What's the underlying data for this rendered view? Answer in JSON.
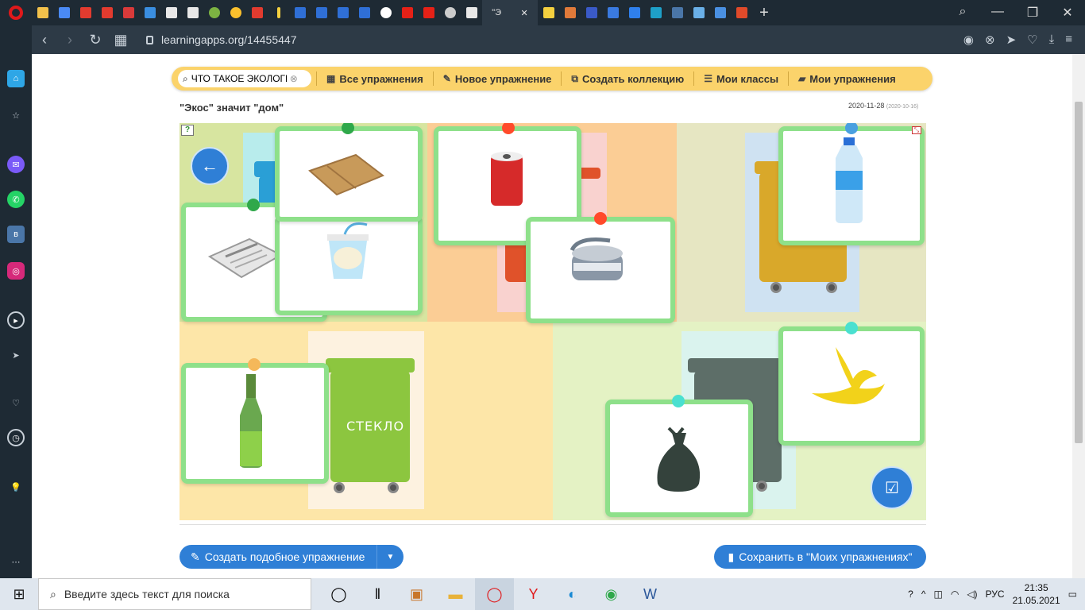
{
  "browser": {
    "active_tab_title": "\"Э",
    "url": "learningapps.org/14455447"
  },
  "toolbar": {
    "search_value": "ЧТО ТАКОЕ ЭКОЛОГИЯ",
    "all_exercises": "Все упражнения",
    "new_exercise": "Новое упражнение",
    "create_collection": "Создать коллекцию",
    "my_classes": "Мои классы",
    "my_exercises": "Мои упражнения"
  },
  "exercise": {
    "title": "\"Экос\" значит \"дом\"",
    "date": "2020-11-28",
    "date_original": "(2020-10-16)"
  },
  "game": {
    "bins": [
      {
        "name": "blue-bin",
        "color": "#2a9fd6"
      },
      {
        "name": "red-bin",
        "color": "#e0522a"
      },
      {
        "name": "yellow-bin",
        "color": "#d9a82a"
      },
      {
        "name": "green-bin",
        "color": "#8cc63f",
        "label": "СТЕКЛО"
      },
      {
        "name": "grey-bin",
        "color": "#5d6e68"
      }
    ],
    "cards": [
      {
        "item": "cardboard",
        "pin_color": "#2fa84a"
      },
      {
        "item": "newspaper",
        "pin_color": "#2fa84a"
      },
      {
        "item": "yogurt-cup",
        "pin_color": "#2fa84a"
      },
      {
        "item": "soda-can",
        "pin_color": "#ff4a2a"
      },
      {
        "item": "tin-can",
        "pin_color": "#ff4a2a"
      },
      {
        "item": "plastic-bottle",
        "pin_color": "#4aa0e0"
      },
      {
        "item": "glass-bottle",
        "pin_color": "#f5b85a"
      },
      {
        "item": "banana-peel",
        "pin_color": "#4ae0d0"
      },
      {
        "item": "trash-bag",
        "pin_color": "#4ae0d0"
      }
    ]
  },
  "actions": {
    "create_similar": "Создать подобное упражнение",
    "save_to_mine": "Сохранить в \"Моих упражнениях\""
  },
  "taskbar": {
    "search_placeholder": "Введите здесь текст для поиска",
    "language": "РУС",
    "time": "21:35",
    "date": "21.05.2021"
  }
}
